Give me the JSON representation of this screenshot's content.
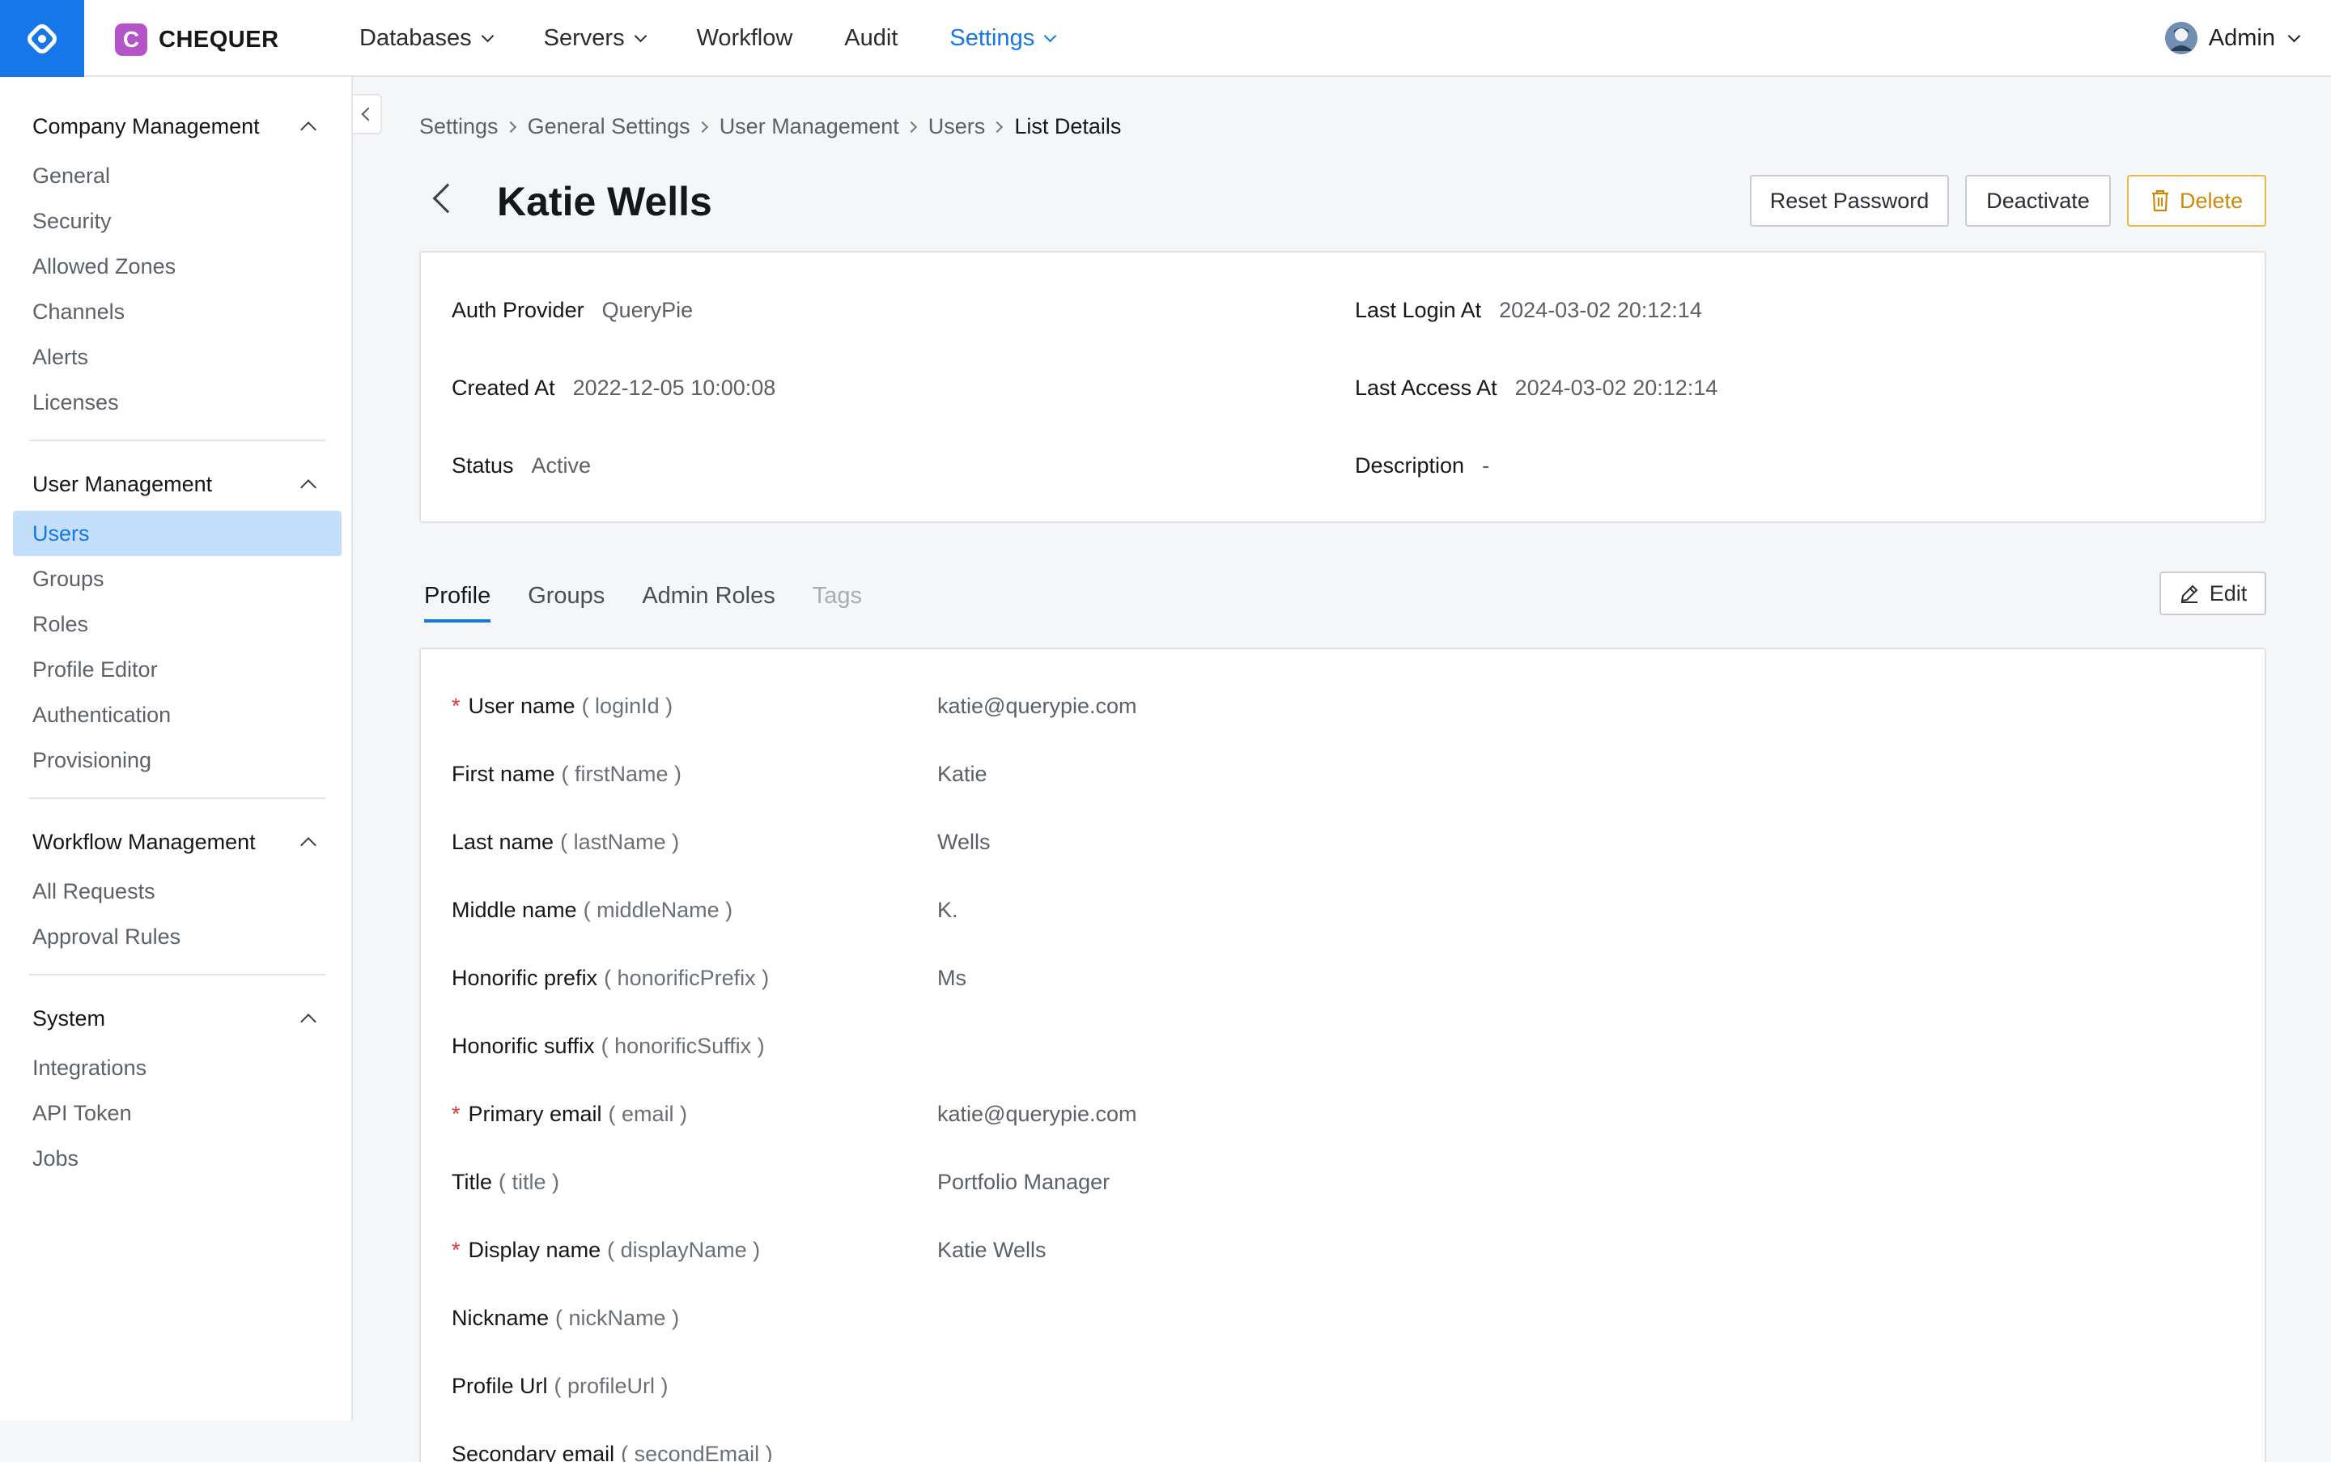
{
  "brand": {
    "name": "CHEQUER",
    "badge": "C",
    "accent": "#1677e8",
    "badge_color": "#b554c8"
  },
  "nav": {
    "items": [
      {
        "label": "Databases",
        "dropdown": true
      },
      {
        "label": "Servers",
        "dropdown": true
      },
      {
        "label": "Workflow",
        "dropdown": false
      },
      {
        "label": "Audit",
        "dropdown": false
      },
      {
        "label": "Settings",
        "dropdown": true,
        "active": true
      }
    ],
    "user": "Admin"
  },
  "sidebar": {
    "sections": [
      {
        "title": "Company Management",
        "items": [
          "General",
          "Security",
          "Allowed Zones",
          "Channels",
          "Alerts",
          "Licenses"
        ]
      },
      {
        "title": "User Management",
        "items": [
          "Users",
          "Groups",
          "Roles",
          "Profile Editor",
          "Authentication",
          "Provisioning"
        ],
        "active_item": "Users"
      },
      {
        "title": "Workflow Management",
        "items": [
          "All Requests",
          "Approval Rules"
        ]
      },
      {
        "title": "System",
        "items": [
          "Integrations",
          "API Token",
          "Jobs"
        ]
      }
    ]
  },
  "breadcrumb": [
    "Settings",
    "General Settings",
    "User Management",
    "Users",
    "List Details"
  ],
  "page": {
    "title": "Katie Wells",
    "actions": {
      "reset": "Reset Password",
      "deactivate": "Deactivate",
      "delete": "Delete"
    }
  },
  "summary": {
    "auth_provider": {
      "label": "Auth Provider",
      "value": "QueryPie"
    },
    "created_at": {
      "label": "Created At",
      "value": "2022-12-05 10:00:08"
    },
    "status": {
      "label": "Status",
      "value": "Active"
    },
    "last_login": {
      "label": "Last Login At",
      "value": "2024-03-02 20:12:14"
    },
    "last_access": {
      "label": "Last Access At",
      "value": "2024-03-02 20:12:14"
    },
    "description": {
      "label": "Description",
      "value": "-"
    }
  },
  "tabs": [
    {
      "label": "Profile",
      "state": "active"
    },
    {
      "label": "Groups",
      "state": "normal"
    },
    {
      "label": "Admin Roles",
      "state": "normal"
    },
    {
      "label": "Tags",
      "state": "disabled"
    }
  ],
  "edit_label": "Edit",
  "profile_fields": [
    {
      "name": "User name",
      "key": "( loginId )",
      "value": "katie@querypie.com",
      "required": true
    },
    {
      "name": "First name",
      "key": "( firstName )",
      "value": "Katie",
      "required": false
    },
    {
      "name": "Last name",
      "key": "( lastName )",
      "value": "Wells",
      "required": false
    },
    {
      "name": "Middle name",
      "key": "( middleName )",
      "value": "K.",
      "required": false
    },
    {
      "name": "Honorific prefix",
      "key": "( honorificPrefix )",
      "value": "Ms",
      "required": false
    },
    {
      "name": "Honorific suffix",
      "key": "( honorificSuffix )",
      "value": "",
      "required": false
    },
    {
      "name": "Primary email",
      "key": "( email )",
      "value": "katie@querypie.com",
      "required": true
    },
    {
      "name": "Title",
      "key": "( title )",
      "value": "Portfolio Manager",
      "required": false
    },
    {
      "name": "Display name",
      "key": "( displayName )",
      "value": "Katie Wells",
      "required": true
    },
    {
      "name": "Nickname",
      "key": "( nickName )",
      "value": "",
      "required": false
    },
    {
      "name": "Profile Url",
      "key": "( profileUrl )",
      "value": "",
      "required": false
    },
    {
      "name": "Secondary email",
      "key": "( secondEmail )",
      "value": "",
      "required": false
    }
  ]
}
